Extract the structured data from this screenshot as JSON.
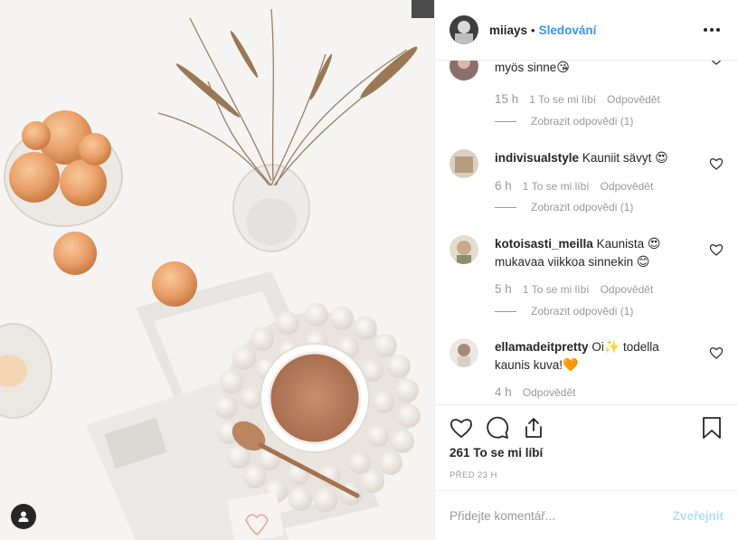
{
  "post": {
    "username": "miiays",
    "separator": "•",
    "follow_label": "Sledování",
    "more_icon": "more-options-icon"
  },
  "comments": [
    {
      "username": "",
      "text": "myös sinne",
      "emoji": "😘",
      "time": "15 h",
      "likes_label": "1 To se mi líbí",
      "reply_label": "Odpovědět",
      "view_replies": "Zobrazit odpovědi (1)"
    },
    {
      "username": "indivisualstyle",
      "text": "Kauniit sävyt",
      "emoji": "😍",
      "time": "6 h",
      "likes_label": "1 To se mi líbí",
      "reply_label": "Odpovědět",
      "view_replies": "Zobrazit odpovědi (1)"
    },
    {
      "username": "kotoisasti_meilla",
      "text": "Kaunista",
      "emoji": "😍",
      "text2": "mukavaa viikkoa sinnekin",
      "emoji2": "😊",
      "time": "5 h",
      "likes_label": "1 To se mi líbí",
      "reply_label": "Odpovědět",
      "view_replies": "Zobrazit odpovědi (1)"
    },
    {
      "username": "ellamadeitpretty",
      "text": "Oi",
      "emoji": "✨",
      "text_after": "todella",
      "text2": "kaunis kuva!",
      "emoji2": "🧡",
      "time": "4 h",
      "reply_label": "Odpovědět"
    }
  ],
  "actions": {
    "likes": "261 To se mi líbí",
    "time_ago": "PŘED 23 H"
  },
  "add_comment": {
    "placeholder": "Přidejte komentář...",
    "post_label": "Zveřejnit"
  },
  "colors": {
    "accent": "#3897f0",
    "post_disabled": "#b2dffc",
    "muted": "#999999",
    "text": "#262626"
  }
}
